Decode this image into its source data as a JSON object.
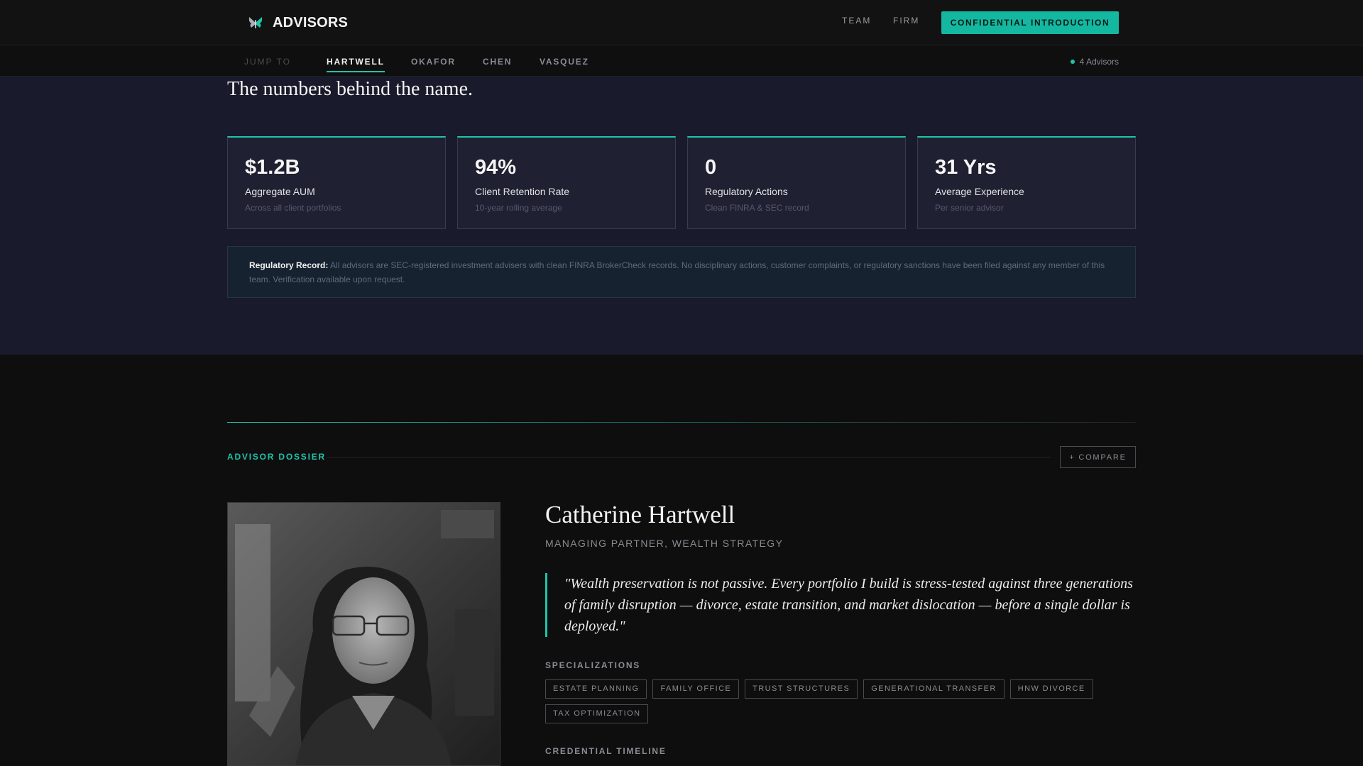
{
  "header": {
    "brand": "ADVISORS",
    "logo_icon": "butterfly-logo-icon",
    "nav": [
      "TEAM",
      "FIRM"
    ],
    "cta": "CONFIDENTIAL INTRODUCTION",
    "accent_color": "#14b8a0"
  },
  "jump": {
    "label": "JUMP TO",
    "tabs": [
      "HARTWELL",
      "OKAFOR",
      "CHEN",
      "VASQUEZ"
    ],
    "active_tab": "HARTWELL",
    "count": "4 Advisors"
  },
  "stats": {
    "heading": "The numbers behind the name.",
    "cards": [
      {
        "value": "$1.2B",
        "label": "Aggregate AUM",
        "sub": "Across all client portfolios"
      },
      {
        "value": "94%",
        "label": "Client Retention Rate",
        "sub": "10-year rolling average"
      },
      {
        "value": "0",
        "label": "Regulatory Actions",
        "sub": "Clean FINRA & SEC record"
      },
      {
        "value": "31 Yrs",
        "label": "Average Experience",
        "sub": "Per senior advisor"
      }
    ],
    "regulatory": {
      "title": "Regulatory Record:",
      "text": "All advisors are SEC-registered investment advisers with clean FINRA BrokerCheck records. No disciplinary actions, customer complaints, or regulatory sanctions have been filed against any member of this team. Verification available upon request."
    }
  },
  "dossier": {
    "label": "ADVISOR DOSSIER",
    "compare": "+ COMPARE",
    "name": "Catherine Hartwell",
    "title": "MANAGING PARTNER, WEALTH STRATEGY",
    "quote": "\"Wealth preservation is not passive. Every portfolio I build is stress-tested against three generations of family disruption — divorce, estate transition, and market dislocation — before a single dollar is deployed.\"",
    "specializations_heading": "SPECIALIZATIONS",
    "specializations": [
      "ESTATE PLANNING",
      "FAMILY OFFICE",
      "TRUST STRUCTURES",
      "GENERATIONAL TRANSFER",
      "HNW DIVORCE",
      "TAX OPTIMIZATION"
    ],
    "credential_heading": "CREDENTIAL TIMELINE"
  }
}
